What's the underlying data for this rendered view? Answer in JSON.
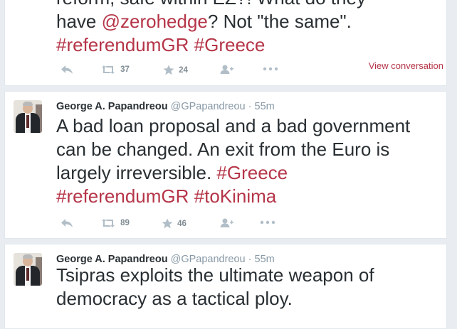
{
  "accent_color": "#b53548",
  "tweets": [
    {
      "lines": [
        {
          "text_parts": [
            "reform, safe within EZ?! What do they"
          ]
        },
        {
          "pre": "have ",
          "mention": "@zerohedge",
          "post": "? Not \"the same\"."
        },
        {
          "tags": "#referendumGR #Greece"
        }
      ],
      "retweets": "37",
      "favorites": "24",
      "view_conversation": "View conversation"
    },
    {
      "author": "George A. Papandreou",
      "handle": "@GPapandreou",
      "separator": "·",
      "time": "55m",
      "lines": [
        "A bad loan proposal and a bad government",
        "can be changed. An exit from the Euro is",
        "largely irreversible. "
      ],
      "tag_inline": "#Greece",
      "tags_line": "#referendumGR #toKinima",
      "retweets": "89",
      "favorites": "46"
    },
    {
      "author": "George A. Papandreou",
      "handle": "@GPapandreou",
      "separator": "·",
      "time": "55m",
      "lines": [
        "Tsipras exploits the ultimate weapon of",
        "democracy as a tactical ploy."
      ]
    }
  ],
  "icons": {
    "reply": "reply-icon",
    "retweet": "retweet-icon",
    "favorite": "star-icon",
    "follow": "follow-icon",
    "more": "more-icon"
  }
}
